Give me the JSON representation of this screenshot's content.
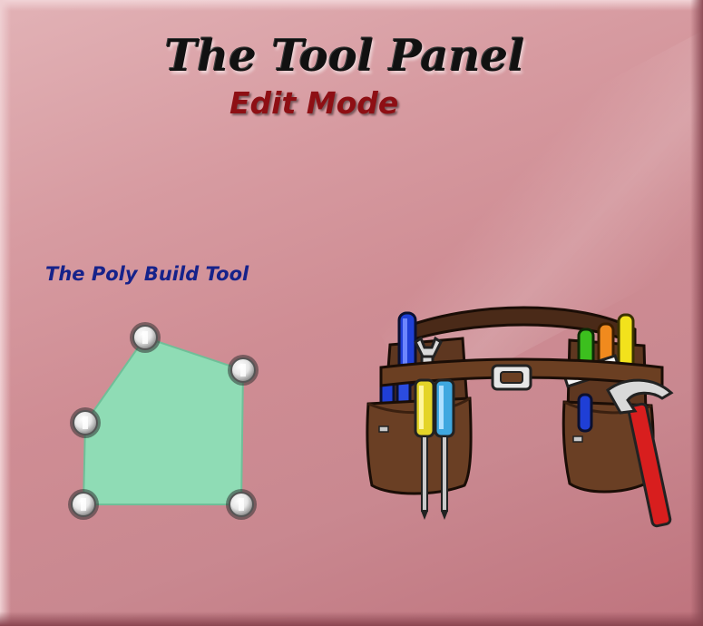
{
  "header": {
    "title": "The Tool Panel",
    "subtitle": "Edit Mode"
  },
  "section": {
    "label": "The Poly Build Tool"
  },
  "colors": {
    "background": "#d79ba1",
    "title": "#111111",
    "subtitle": "#8e0f14",
    "label": "#16228a",
    "polygon_fill": "#8fdcb5"
  },
  "icons": {
    "poly_build": "poly-build-icon",
    "tool_belt": "tool-belt-illustration"
  }
}
